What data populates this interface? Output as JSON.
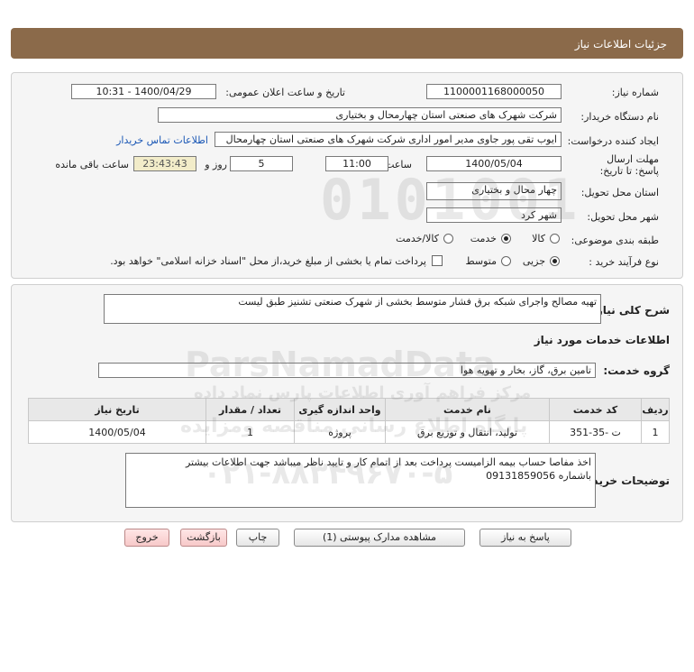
{
  "header": {
    "title": "جزئیات اطلاعات نیاز"
  },
  "form": {
    "need_number_label": "شماره نیاز:",
    "need_number": "1100001168000050",
    "announce_label": "تاریخ و ساعت اعلان عمومی:",
    "announce_value": "1400/04/29 - 10:31",
    "buyer_org_label": "نام دستگاه خریدار:",
    "buyer_org": "شرکت شهرک های صنعتی استان چهارمحال و بختیاری",
    "creator_label": "ایجاد کننده درخواست:",
    "creator": "ایوب تقی پور جاوی مدیر امور اداری شرکت شهرک های صنعتی استان چهارمحال",
    "contact_link": "اطلاعات تماس خریدار",
    "deadline_label": "مهلت ارسال پاسخ: تا تاریخ:",
    "deadline_date": "1400/05/04",
    "time_label": "ساعت",
    "deadline_time": "11:00",
    "days_value": "5",
    "days_label": "روز و",
    "remaining_time": "23:43:43",
    "remaining_label": "ساعت باقی مانده",
    "province_label": "استان محل تحویل:",
    "province": "چهار محال و بختیاری",
    "city_label": "شهر محل تحویل:",
    "city": "شهر کرد",
    "category_label": "طبقه بندی موضوعی:",
    "category_options": [
      "کالا",
      "خدمت",
      "کالا/خدمت"
    ],
    "process_label": "نوع فرآیند خرید :",
    "process_options": [
      "جزیی",
      "متوسط"
    ],
    "payment_note": "پرداخت تمام یا بخشی از مبلغ خرید،از محل \"اسناد خزانه اسلامی\" خواهد بود."
  },
  "summary": {
    "label": "شرح کلی نیاز:",
    "text": "تهیه مصالح  واجرای شبکه برق فشار متوسط  بخشی   از شهرک صنعتی تشنیز طبق لیست",
    "services_heading": "اطلاعات خدمات مورد نیاز",
    "service_group_label": "گروه خدمت:",
    "service_group": "تامین برق، گاز، بخار و تهویه هوا"
  },
  "table": {
    "headers": [
      "ردیف",
      "کد خدمت",
      "نام خدمت",
      "واحد اندازه گیری",
      "تعداد / مقدار",
      "تاریخ نیاز"
    ],
    "rows": [
      [
        "1",
        "ت -35-351",
        "تولید، انتقال و توزیع برق",
        "پروژه",
        "1",
        "1400/05/04"
      ]
    ]
  },
  "buyer_notes": {
    "label": "توضیحات خریدار:",
    "line1": "اخذ مفاصا حساب بیمه الزامیست پرداخت بعد از اتمام کار و تایید ناظر میباشد جهت اطلاعات بیشتر",
    "line2": "باشماره 09131859056"
  },
  "buttons": {
    "reply": "پاسخ به نیاز",
    "view_docs": "مشاهده مدارک پیوستی (1)",
    "print": "چاپ",
    "back": "بازگشت",
    "exit": "خروج"
  },
  "watermark": {
    "digits": "0101001",
    "site": "ParsNamadData",
    "line1": "مرکز فراهم آوری اطلاعات پارس نماد داده",
    "line2": "پایگاه اطلاع رسانی مناقصه ومزایده",
    "phone": "۰۲۱-۸۸۳۴۹۶۷۰-۵"
  }
}
